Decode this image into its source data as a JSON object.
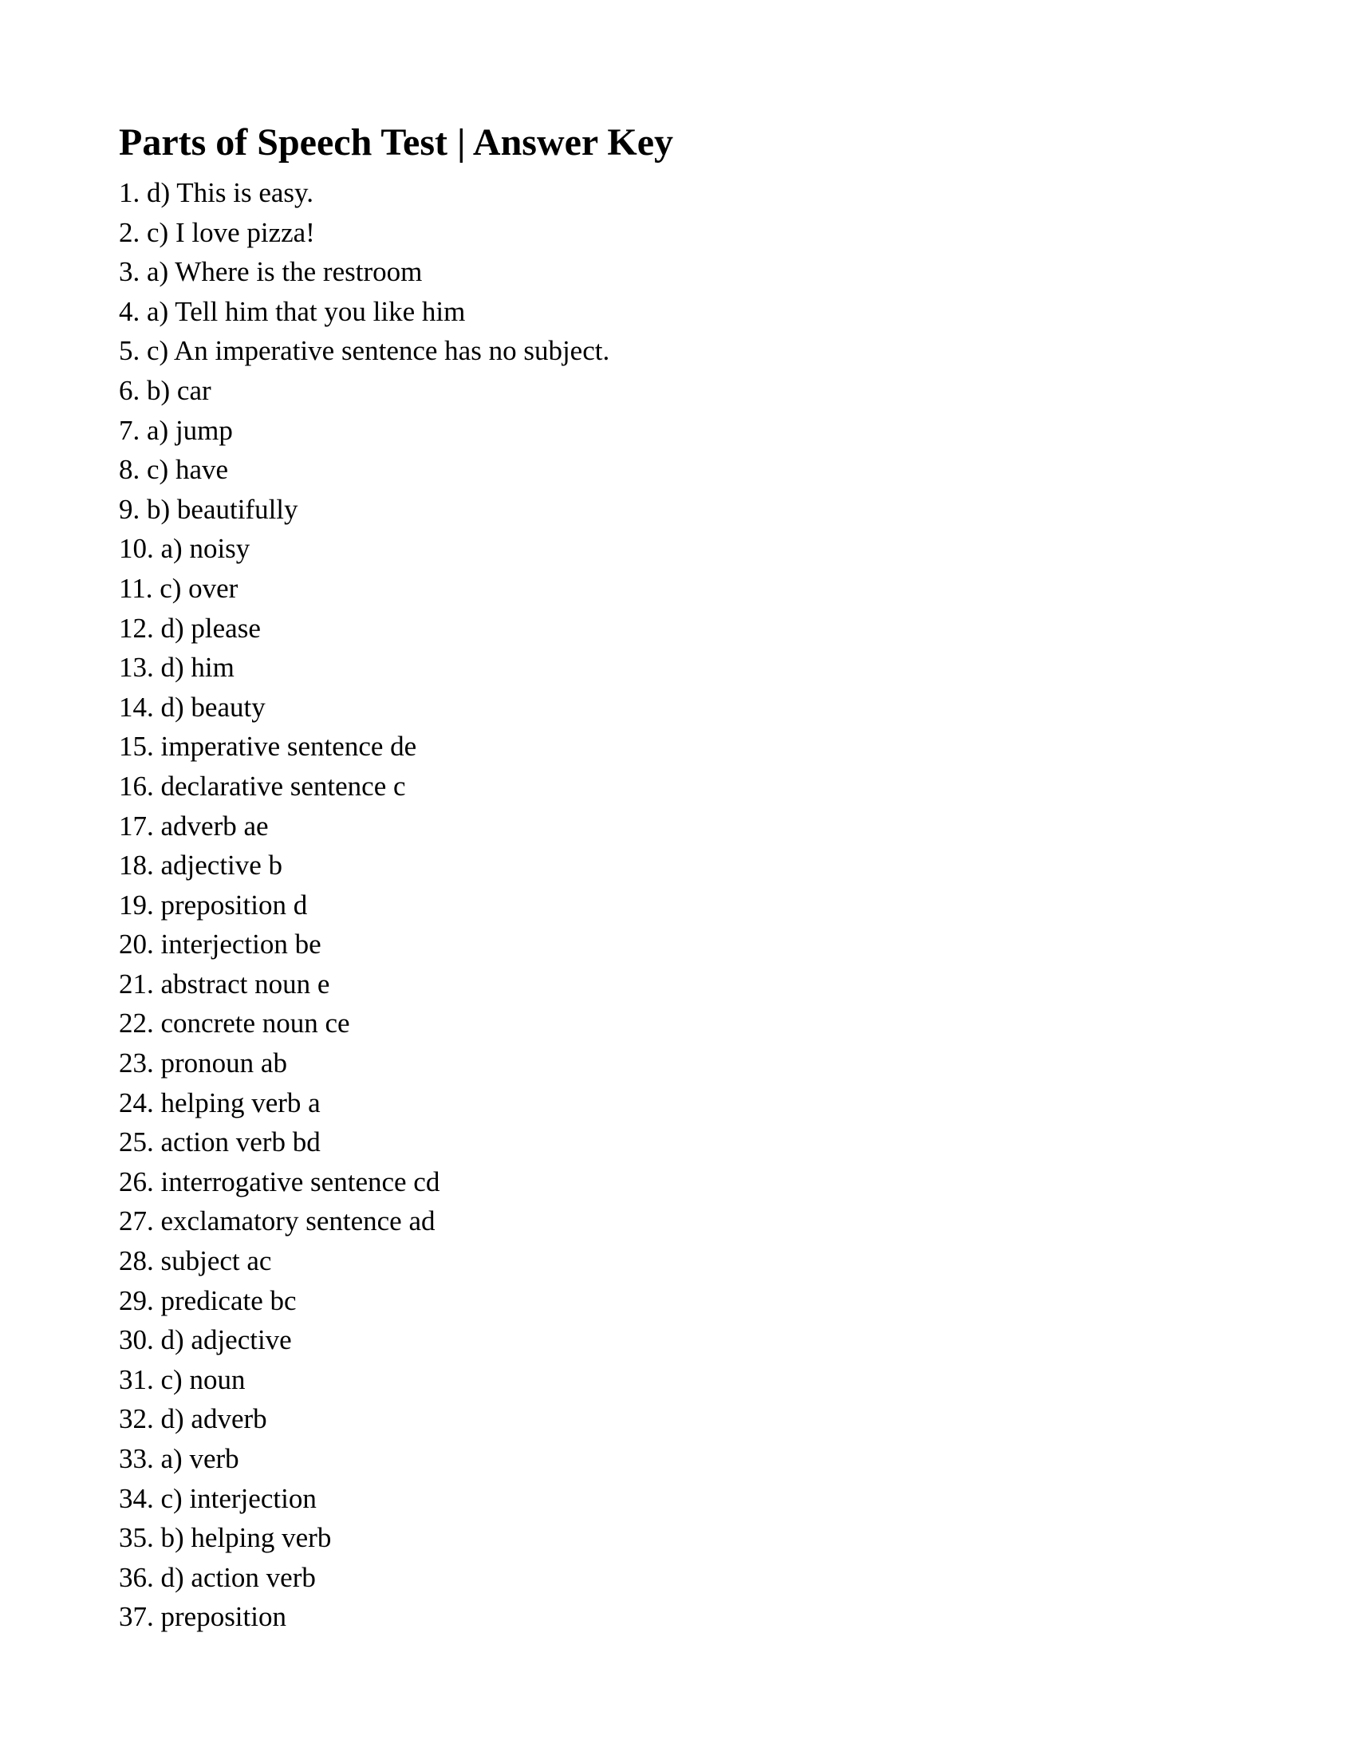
{
  "title": "Parts of Speech Test | Answer Key",
  "answers": [
    "1. d) This is easy.",
    "2. c) I love pizza!",
    "3. a) Where is the restroom",
    "4. a) Tell him that you like him",
    "5. c) An imperative sentence has no subject.",
    "6. b) car",
    "7. a) jump",
    "8. c) have",
    "9. b) beautifully",
    "10. a) noisy",
    "11. c) over",
    "12. d) please",
    "13. d) him",
    "14. d) beauty",
    "15. imperative sentence de",
    "16. declarative sentence c",
    "17. adverb ae",
    "18. adjective b",
    "19. preposition d",
    "20. interjection be",
    "21. abstract noun e",
    "22. concrete noun ce",
    "23. pronoun ab",
    "24. helping verb a",
    "25. action verb bd",
    "26. interrogative sentence cd",
    "27. exclamatory sentence ad",
    "28. subject ac",
    "29. predicate bc",
    "30. d) adjective",
    "31. c) noun",
    "32. d) adverb",
    "33. a) verb",
    "34. c) interjection",
    "35. b) helping verb",
    "36. d) action verb",
    "37. preposition"
  ]
}
